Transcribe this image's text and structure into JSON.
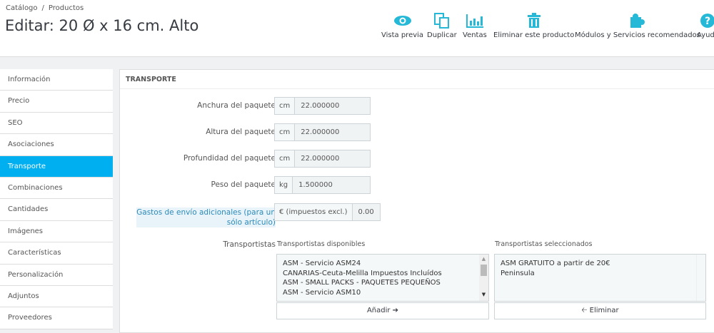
{
  "breadcrumb": [
    "Catálogo",
    "/",
    "Productos"
  ],
  "title": "Editar: 20 Ø x 16 cm. Alto",
  "toolbar": [
    {
      "label": "Vista previa",
      "icon": "eye-icon"
    },
    {
      "label": "Duplicar",
      "icon": "copy-icon"
    },
    {
      "label": "Ventas",
      "icon": "bar-chart-icon"
    },
    {
      "label": "Eliminar este producto",
      "icon": "trash-icon"
    },
    {
      "label": "Módulos y Servicios recomendados",
      "icon": "puzzle-icon"
    },
    {
      "label": "Ayuda",
      "icon": "help-icon"
    }
  ],
  "sidebar": [
    "Información",
    "Precio",
    "SEO",
    "Asociaciones",
    "Transporte",
    "Combinaciones",
    "Cantidades",
    "Imágenes",
    "Características",
    "Personalización",
    "Adjuntos",
    "Proveedores"
  ],
  "panel": {
    "title": "TRANSPORTE",
    "fields": [
      {
        "label": "Anchura del paquete",
        "unit": "cm",
        "value": "22.000000"
      },
      {
        "label": "Altura del paquete",
        "unit": "cm",
        "value": "22.000000"
      },
      {
        "label": "Profundidad del paquete",
        "unit": "cm",
        "value": "22.000000"
      },
      {
        "label": "Peso del paquete",
        "unit": "kg",
        "value": "1.500000"
      }
    ],
    "shipping": {
      "label1": "Gastos de envío adicionales (para un",
      "label2": "sólo artículo)",
      "unit": "€ (impuestos excl.)",
      "value": "0.00"
    },
    "carriers_label": "Transportistas",
    "available_label": "Transportistas disponibles",
    "available": [
      "ASM - Servicio ASM24",
      "CANARIAS-Ceuta-Melilla Impuestos Incluídos",
      "ASM - SMALL PACKS - PAQUETES PEQUEÑOS",
      "ASM - Servicio ASM10"
    ],
    "selected_label": "Transportistas seleccionados",
    "selected": [
      "ASM GRATUITO a partir de 20€",
      "Peninsula"
    ],
    "add": "Añadir ➔",
    "remove": "🡠 Eliminar"
  }
}
